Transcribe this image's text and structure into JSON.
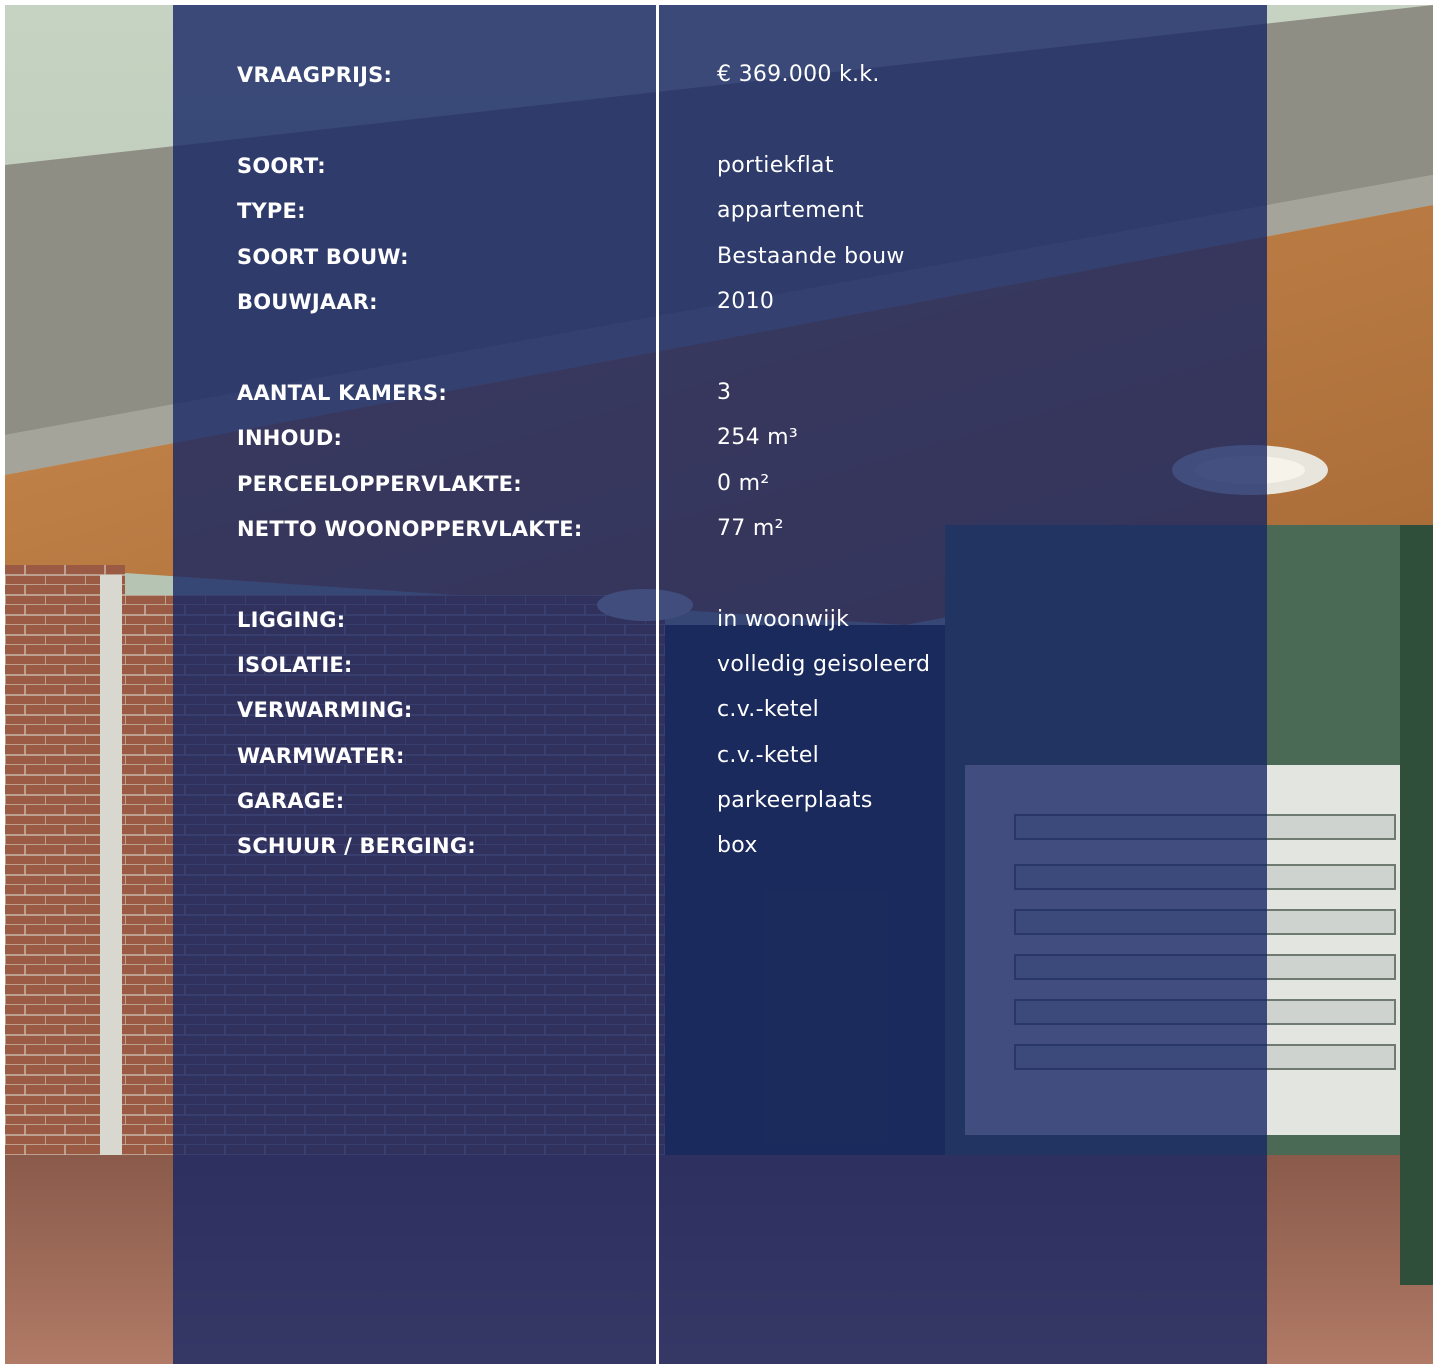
{
  "specs": [
    {
      "label": "VRAAGPRIJS:",
      "value": "€ 369.000 k.k."
    },
    {
      "label": "SOORT:",
      "value": "portiekflat"
    },
    {
      "label": "TYPE:",
      "value": "appartement"
    },
    {
      "label": "SOORT BOUW:",
      "value": "Bestaande bouw"
    },
    {
      "label": "BOUWJAAR:",
      "value": "2010"
    },
    {
      "label": "AANTAL KAMERS:",
      "value": "3"
    },
    {
      "label": "INHOUD:",
      "value": "254 m³"
    },
    {
      "label": "PERCEELOPPERVLAKTE:",
      "value": "0 m²"
    },
    {
      "label": "NETTO WOONOPPERVLAKTE:",
      "value": "77 m²"
    },
    {
      "label": "LIGGING:",
      "value": "in woonwijk"
    },
    {
      "label": "ISOLATIE:",
      "value": "volledig geisoleerd"
    },
    {
      "label": "VERWARMING:",
      "value": "c.v.-ketel"
    },
    {
      "label": "WARMWATER:",
      "value": "c.v.-ketel"
    },
    {
      "label": "GARAGE:",
      "value": "parkeerplaats"
    },
    {
      "label": "SCHUUR / BERGING:",
      "value": "box"
    }
  ],
  "colors": {
    "overlay": "#162765",
    "text": "#ffffff"
  }
}
